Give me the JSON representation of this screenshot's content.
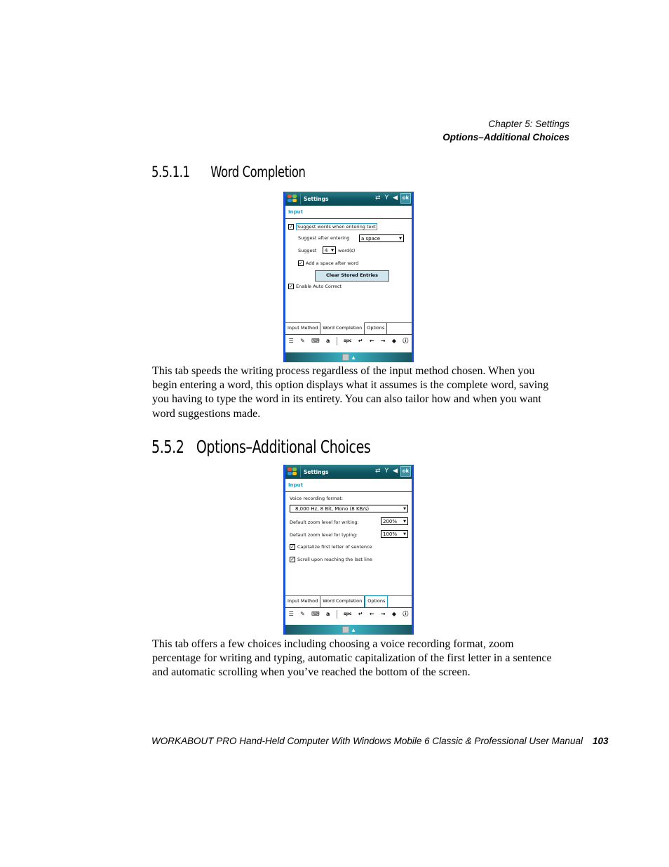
{
  "running_head": {
    "chapter": "Chapter  5:  Settings",
    "section": "Options–Additional Choices"
  },
  "section_5511": {
    "number": "5.5.1.1",
    "title": "Word Completion",
    "paragraph": "This tab speeds the writing process regardless of the input method chosen. When you begin entering a word, this option displays what it assumes is the complete word, saving you having to type the word in its entirety. You can also tailor how and when you want word suggestions made."
  },
  "section_552": {
    "number": "5.5.2",
    "title": "Options–Additional Choices",
    "paragraph": "This tab offers a few choices including choosing a voice recording format, zoom percentage for writing and typing, automatic capitalization of the first letter in a sentence and automatic scrolling when you’ve reached the bottom of the screen."
  },
  "screen1": {
    "title": "Settings",
    "ok_label": "ok",
    "status_icons": [
      "sync-icon",
      "signal-icon",
      "speaker-icon"
    ],
    "header": "Input",
    "suggest_words_label": "Suggest words when entering text",
    "suggest_words_checked": true,
    "suggest_after_label": "Suggest after entering",
    "suggest_after_value": "a space",
    "suggest_label": "Suggest",
    "suggest_count": "4",
    "words_label": "word(s)",
    "add_space_label": "Add a space after word",
    "add_space_checked": true,
    "clear_button": "Clear Stored Entries",
    "auto_correct_label": "Enable Auto Correct",
    "auto_correct_checked": true,
    "tabs": [
      "Input Method",
      "Word Completion",
      "Options"
    ],
    "active_tab": "Word Completion"
  },
  "screen2": {
    "title": "Settings",
    "ok_label": "ok",
    "header": "Input",
    "voice_format_label": "Voice recording format:",
    "voice_format_value": "8,000 Hz, 8 Bit, Mono (8 KB/s)",
    "zoom_writing_label": "Default zoom level for writing:",
    "zoom_writing_value": "200%",
    "zoom_typing_label": "Default zoom level for typing:",
    "zoom_typing_value": "100%",
    "capitalize_label": "Capitalize first letter of sentence",
    "capitalize_checked": true,
    "scroll_label": "Scroll upon reaching the last line",
    "scroll_checked": true,
    "tabs": [
      "Input Method",
      "Word Completion",
      "Options"
    ],
    "active_tab": "Options"
  },
  "keyboard_bar": {
    "keys": [
      "≡",
      "✎",
      "⌨",
      "a",
      "spc",
      "↵",
      "←",
      "→",
      "◆",
      "?"
    ]
  },
  "footer": {
    "manual_title": "WORKABOUT PRO Hand-Held Computer With Windows Mobile 6 Classic & Professional User Manual",
    "page_number": "103"
  }
}
